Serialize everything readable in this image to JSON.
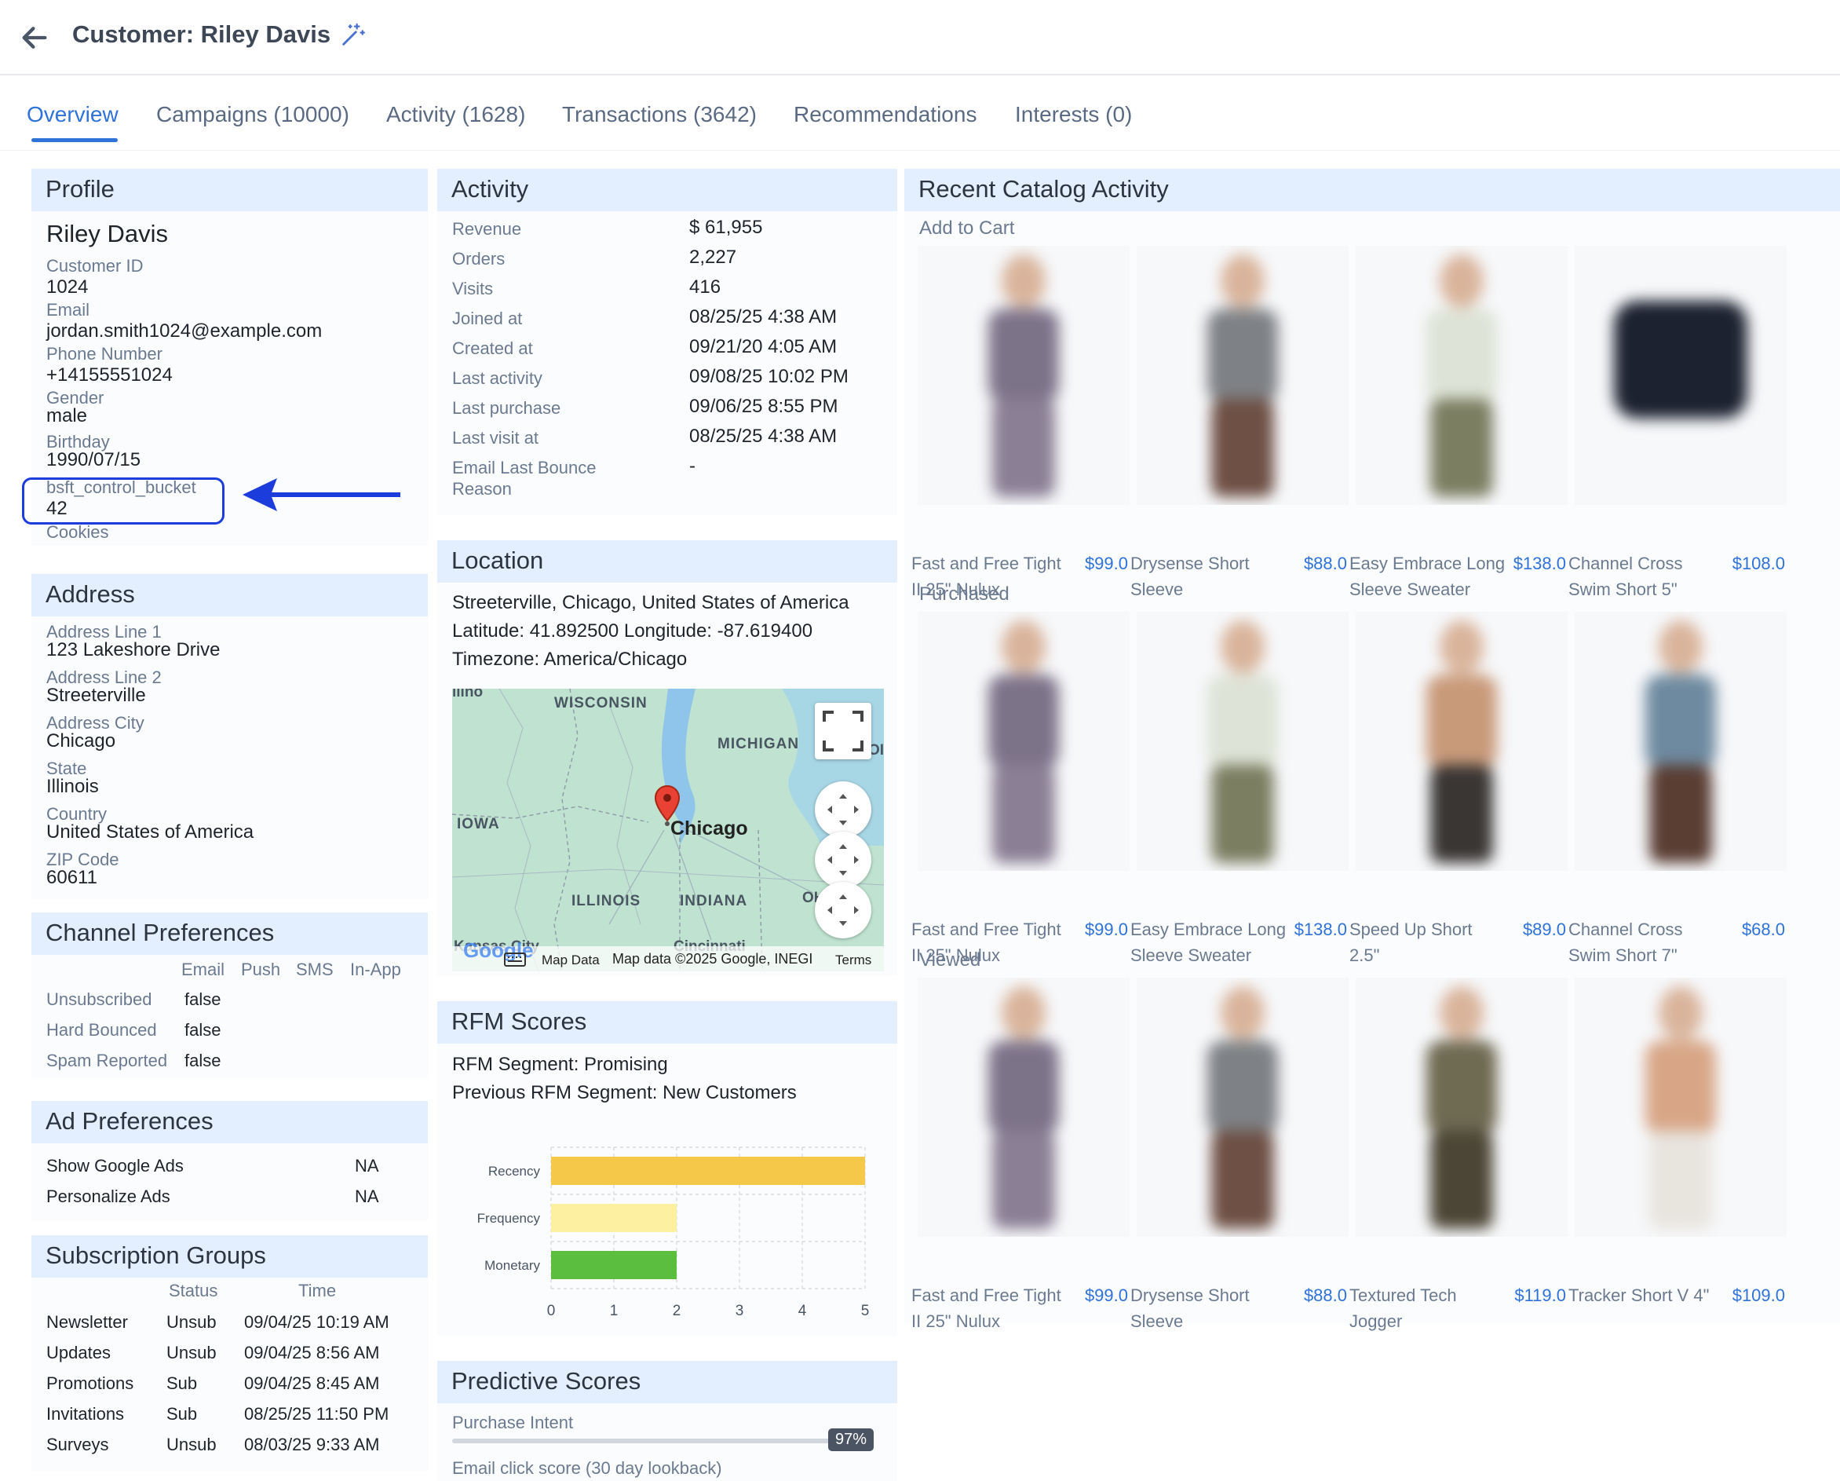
{
  "header": {
    "title": "Customer: Riley Davis"
  },
  "tabs": [
    {
      "label": "Overview"
    },
    {
      "label": "Campaigns (10000)"
    },
    {
      "label": "Activity (1628)"
    },
    {
      "label": "Transactions (3642)"
    },
    {
      "label": "Recommendations"
    },
    {
      "label": "Interests (0)"
    }
  ],
  "profile": {
    "title": "Profile",
    "name": "Riley Davis",
    "fields": [
      {
        "label": "Customer ID",
        "value": "1024"
      },
      {
        "label": "Email",
        "value": "jordan.smith1024@example.com"
      },
      {
        "label": "Phone Number",
        "value": "+14155551024"
      },
      {
        "label": "Gender",
        "value": "male"
      },
      {
        "label": "Birthday",
        "value": "1990/07/15"
      },
      {
        "label": "bsft_control_bucket",
        "value": "42"
      }
    ],
    "cookies_label": "Cookies"
  },
  "address": {
    "title": "Address",
    "fields": [
      {
        "label": "Address Line 1",
        "value": "123 Lakeshore Drive"
      },
      {
        "label": "Address Line 2",
        "value": "Streeterville"
      },
      {
        "label": "Address City",
        "value": "Chicago"
      },
      {
        "label": "State",
        "value": "Illinois"
      },
      {
        "label": "Country",
        "value": "United States of America"
      },
      {
        "label": "ZIP Code",
        "value": "60611"
      }
    ]
  },
  "channel": {
    "title": "Channel Preferences",
    "columns": [
      "Email",
      "Push",
      "SMS",
      "In-App"
    ],
    "rows": [
      {
        "label": "Unsubscribed",
        "email": "false"
      },
      {
        "label": "Hard Bounced",
        "email": "false"
      },
      {
        "label": "Spam Reported",
        "email": "false"
      }
    ]
  },
  "ads": {
    "title": "Ad Preferences",
    "rows": [
      {
        "label": "Show Google Ads",
        "value": "NA"
      },
      {
        "label": "Personalize Ads",
        "value": "NA"
      }
    ]
  },
  "subs": {
    "title": "Subscription Groups",
    "status_col": "Status",
    "time_col": "Time",
    "rows": [
      {
        "name": "Newsletter",
        "status": "Unsub",
        "time": "09/04/25 10:19 AM"
      },
      {
        "name": "Updates",
        "status": "Unsub",
        "time": "09/04/25 8:56 AM"
      },
      {
        "name": "Promotions",
        "status": "Sub",
        "time": "09/04/25 8:45 AM"
      },
      {
        "name": "Invitations",
        "status": "Sub",
        "time": "08/25/25 11:50 PM"
      },
      {
        "name": "Surveys",
        "status": "Unsub",
        "time": "08/03/25 9:33 AM"
      }
    ]
  },
  "activity": {
    "title": "Activity",
    "rows": [
      {
        "label": "Revenue",
        "value": "$ 61,955"
      },
      {
        "label": "Orders",
        "value": "2,227"
      },
      {
        "label": "Visits",
        "value": "416"
      },
      {
        "label": "Joined at",
        "value": "08/25/25 4:38 AM"
      },
      {
        "label": "Created at",
        "value": "09/21/20 4:05 AM"
      },
      {
        "label": "Last activity",
        "value": "09/08/25 10:02 PM"
      },
      {
        "label": "Last purchase",
        "value": "09/06/25 8:55 PM"
      },
      {
        "label": "Last visit at",
        "value": "08/25/25 4:38 AM"
      },
      {
        "label": "Email Last Bounce",
        "value": "-"
      }
    ],
    "bounce_reason": "Reason"
  },
  "location": {
    "title": "Location",
    "place": "Streeterville, Chicago, United States of America",
    "latlon": "Latitude: 41.892500  Longitude: -87.619400",
    "timezone": "Timezone: America/Chicago",
    "map_labels": {
      "wisconsin": "WISCONSIN",
      "michigan": "MICHIGAN",
      "iowa": "IOWA",
      "chicago": "Chicago",
      "illinois": "ILLINOIS",
      "indiana": "INDIANA",
      "oh": "OH",
      "kansas_city": "Kansas City",
      "cincinnati": "Cincinnati",
      "illinois_cut": "llino",
      "oi": "OI"
    },
    "map_footer": {
      "google": "Google",
      "data": "Map Data",
      "copyright": "Map data ©2025 Google, INEGI",
      "terms": "Terms"
    }
  },
  "rfm": {
    "title": "RFM Scores",
    "segment": "RFM Segment: Promising",
    "previous": "Previous RFM Segment: New Customers"
  },
  "chart_data": {
    "type": "bar",
    "orientation": "horizontal",
    "categories": [
      "Recency",
      "Frequency",
      "Monetary"
    ],
    "values": [
      5,
      2,
      2
    ],
    "xlim": [
      0,
      5
    ],
    "xticks": [
      "0",
      "1",
      "2",
      "3",
      "4",
      "5"
    ],
    "colors": [
      "#f5c84a",
      "#fdf0a0",
      "#5cbe3e"
    ],
    "grid": true
  },
  "predictive": {
    "title": "Predictive Scores",
    "purchase_label": "Purchase Intent",
    "purchase_value": "97%",
    "purchase_fraction": 0.97,
    "email_label": "Email click score (30 day lookback)"
  },
  "catalog": {
    "title": "Recent Catalog Activity",
    "sections": [
      {
        "label": "Add to Cart",
        "items": [
          {
            "name": "Fast and Free Tight II 25\" Nulux",
            "price": "$99.0"
          },
          {
            "name": "Drysense Short Sleeve",
            "price": "$88.0"
          },
          {
            "name": "Easy Embrace Long Sleeve Sweater",
            "price": "$138.0"
          },
          {
            "name": "Channel Cross Swim Short 5\"",
            "price": "$108.0"
          }
        ]
      },
      {
        "label": "Purchased",
        "items": [
          {
            "name": "Fast and Free Tight II 25\" Nulux",
            "price": "$99.0"
          },
          {
            "name": "Easy Embrace Long Sleeve Sweater",
            "price": "$138.0"
          },
          {
            "name": "Speed Up Short 2.5\"",
            "price": "$89.0"
          },
          {
            "name": "Channel Cross Swim Short 7\"",
            "price": "$68.0"
          }
        ]
      },
      {
        "label": "Viewed",
        "items": [
          {
            "name": "Fast and Free Tight II 25\" Nulux",
            "price": "$99.0"
          },
          {
            "name": "Drysense Short Sleeve",
            "price": "$88.0"
          },
          {
            "name": "Textured Tech Jogger",
            "price": "$119.0"
          },
          {
            "name": "Tracker Short V 4\"",
            "price": "$109.0"
          }
        ]
      }
    ]
  }
}
